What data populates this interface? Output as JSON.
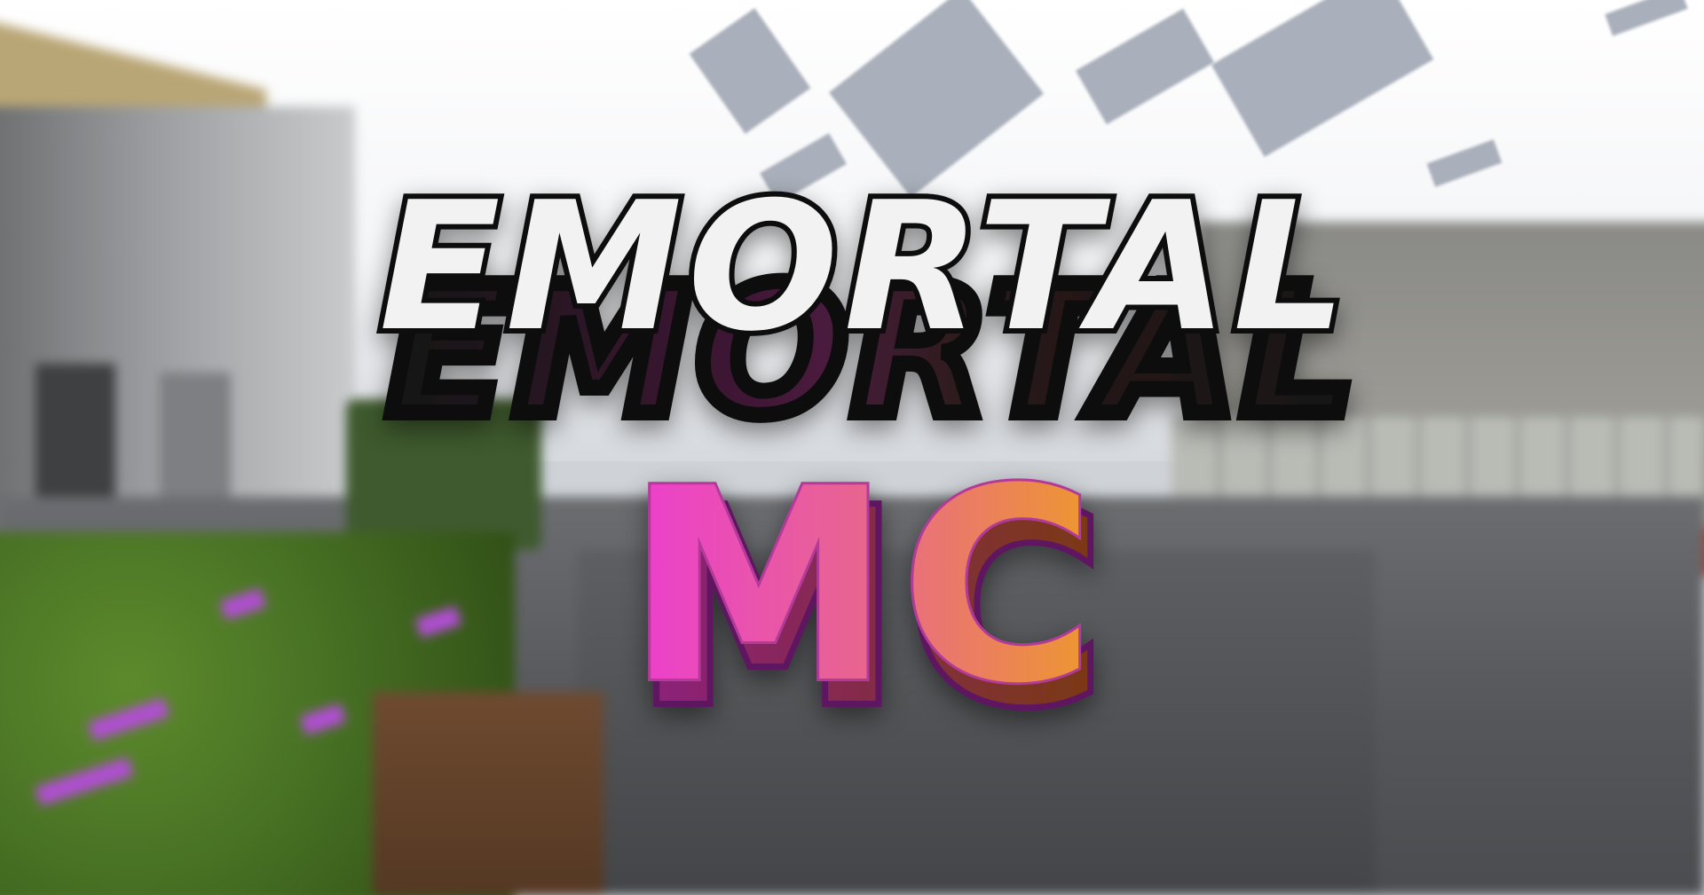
{
  "logo": {
    "line1": "EMORTAL",
    "line2": "MC",
    "line1_face_color": "#f2f2f2",
    "line1_side_color": "#1c1c1c",
    "line2_gradient": [
      "#ec3dd0",
      "#e8668e",
      "#ee9a2a"
    ]
  },
  "scene": {
    "icon": "minecraft-lobby-background",
    "sky_color": "#f4f5f7",
    "cloud_color": "#aab0bb"
  }
}
